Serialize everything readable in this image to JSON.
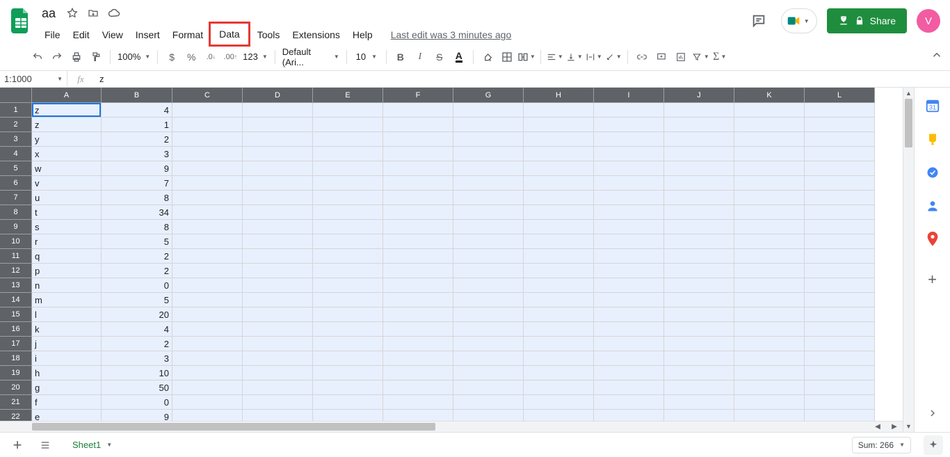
{
  "doc": {
    "title": "aa"
  },
  "menus": [
    "File",
    "Edit",
    "View",
    "Insert",
    "Format",
    "Data",
    "Tools",
    "Extensions",
    "Help"
  ],
  "highlight_menu_index": 5,
  "last_edit": "Last edit was 3 minutes ago",
  "share_label": "Share",
  "avatar_initial": "V",
  "toolbar": {
    "zoom": "100%",
    "currency_symbol": "$",
    "percent_symbol": "%",
    "dec_decrease_label": ".0",
    "dec_increase_label": ".00",
    "more_formats_label": "123",
    "font": "Default (Ari...",
    "font_size": "10",
    "text_color_letter": "A"
  },
  "name_box": "1:1000",
  "fx_label": "fx",
  "formula_value": "z",
  "columns": [
    "A",
    "B",
    "C",
    "D",
    "E",
    "F",
    "G",
    "H",
    "I",
    "J",
    "K",
    "L"
  ],
  "col_widths": {
    "A": 100,
    "B": 102,
    "other": 101
  },
  "rows": [
    {
      "n": 1,
      "a": "z",
      "b": "4"
    },
    {
      "n": 2,
      "a": "z",
      "b": "1"
    },
    {
      "n": 3,
      "a": "y",
      "b": "2"
    },
    {
      "n": 4,
      "a": "x",
      "b": "3"
    },
    {
      "n": 5,
      "a": "w",
      "b": "9"
    },
    {
      "n": 6,
      "a": "v",
      "b": "7"
    },
    {
      "n": 7,
      "a": "u",
      "b": "8"
    },
    {
      "n": 8,
      "a": "t",
      "b": "34"
    },
    {
      "n": 9,
      "a": "s",
      "b": "8"
    },
    {
      "n": 10,
      "a": "r",
      "b": "5"
    },
    {
      "n": 11,
      "a": "q",
      "b": "2"
    },
    {
      "n": 12,
      "a": "p",
      "b": "2"
    },
    {
      "n": 13,
      "a": "n",
      "b": "0"
    },
    {
      "n": 14,
      "a": "m",
      "b": "5"
    },
    {
      "n": 15,
      "a": "l",
      "b": "20"
    },
    {
      "n": 16,
      "a": "k",
      "b": "4"
    },
    {
      "n": 17,
      "a": "j",
      "b": "2"
    },
    {
      "n": 18,
      "a": "i",
      "b": "3"
    },
    {
      "n": 19,
      "a": "h",
      "b": "10"
    },
    {
      "n": 20,
      "a": "g",
      "b": "50"
    },
    {
      "n": 21,
      "a": "f",
      "b": "0"
    },
    {
      "n": 22,
      "a": "e",
      "b": "9"
    }
  ],
  "active_cell": {
    "row": 1,
    "col": "A"
  },
  "sheet_tab": "Sheet1",
  "sum_label": "Sum: 266",
  "side_icons": [
    "calendar-icon",
    "keep-icon",
    "tasks-icon",
    "contacts-icon",
    "maps-icon"
  ],
  "colors": {
    "share": "#1e8e3e",
    "avatar": "#f25ca2",
    "highlight_border": "#e53935",
    "select_bg": "#e8f0fe",
    "header_bg": "#5f6368",
    "active_border": "#1a73e8",
    "tab_text": "#188038"
  }
}
